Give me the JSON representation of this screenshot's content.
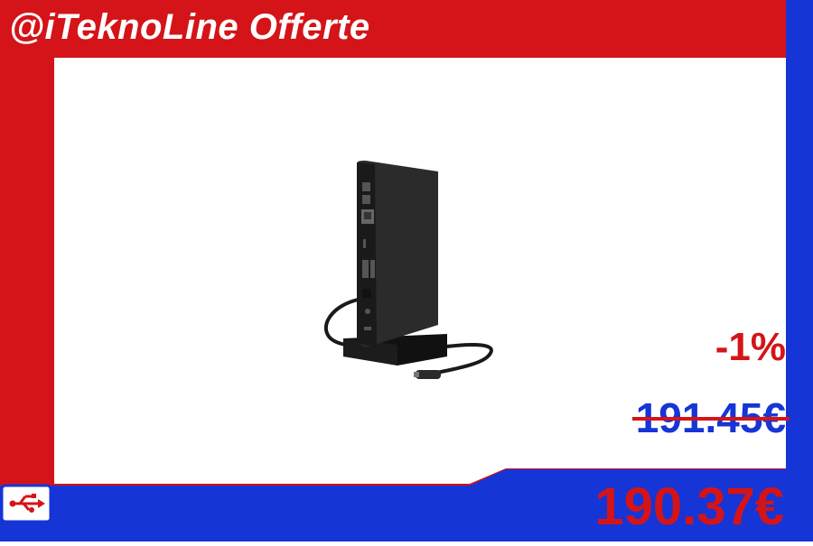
{
  "header": {
    "title": "@iTeknoLine Offerte"
  },
  "product": {
    "image_icon": "docking-station-icon"
  },
  "pricing": {
    "discount": "-1%",
    "old_price": "191.45€",
    "new_price": "190.37€"
  },
  "branding": {
    "logo_icon": "usb-monitor-logo-icon"
  },
  "colors": {
    "red": "#d41418",
    "blue": "#1535d6",
    "white": "#ffffff"
  }
}
